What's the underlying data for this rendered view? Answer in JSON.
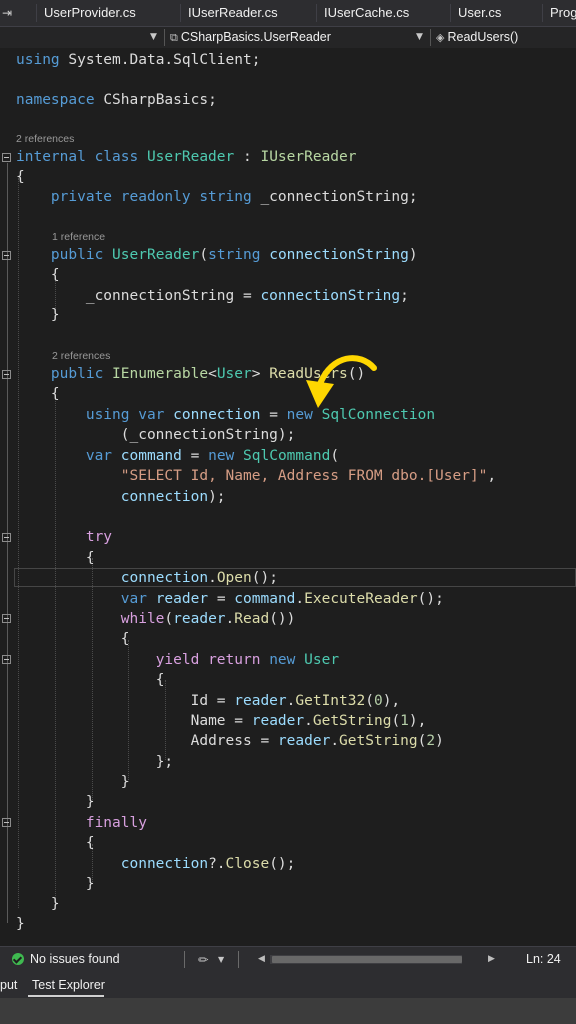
{
  "tabs": [
    {
      "label": "UserProvider.cs",
      "active": true
    },
    {
      "label": "IUserReader.cs"
    },
    {
      "label": "IUserCache.cs"
    },
    {
      "label": "User.cs"
    },
    {
      "label": "Prog"
    }
  ],
  "navigation": {
    "type_label": "CSharpBasics.UserReader",
    "member_label": "ReadUsers()"
  },
  "code_lens": {
    "class_refs": "2 references",
    "ctor_refs": "1 reference",
    "method_refs": "2 references"
  },
  "code": {
    "using_kw": "using",
    "using_ns": "System.Data.SqlClient;",
    "namespace_kw": "namespace",
    "namespace_name": "CSharpBasics;",
    "class_mods": "internal class",
    "class_name": "UserReader",
    "class_colon": ":",
    "interface_name": "IUserReader",
    "brace_open": "{",
    "brace_close": "}",
    "field_mods": "private readonly string",
    "field_name": "_connectionString;",
    "ctor_public": "public",
    "ctor_name": "UserReader",
    "ctor_paren": "(",
    "ctor_param_type": "string",
    "ctor_param_name": "connectionString",
    "ctor_paren_close": ")",
    "assign_lhs": "_connectionString =",
    "assign_rhs": "connectionString",
    "semicolon": ";",
    "method_public": "public",
    "method_return_type": "IEnumerable",
    "lt": "<",
    "generic_arg": "User",
    "gt": ">",
    "method_name": "ReadUsers",
    "method_parens": "()",
    "using_var": "using var",
    "conn_var": "connection",
    "eq": "=",
    "new_kw": "new",
    "sqlconn_type": "SqlConnection",
    "sqlconn_arg": "(_connectionString);",
    "var_kw": "var",
    "cmd_var": "command",
    "sqlcmd_type": "SqlCommand",
    "open_paren": "(",
    "sql_string": "\"SELECT Id, Name, Address FROM dbo.[User]\"",
    "comma": ",",
    "cmd_arg2": "connection",
    "close_paren_semi": ");",
    "try_kw": "try",
    "open_obj": "connection",
    "dot": ".",
    "open_method": "Open",
    "call_end": "();",
    "reader_var": "reader",
    "cmd_obj": "command",
    "exec_method": "ExecuteReader",
    "while_kw": "while",
    "read_method": "Read",
    "while_end": "())",
    "yield_kw": "yield return",
    "user_type": "User",
    "id_prop": "Id =",
    "getint_method": "GetInt32",
    "idx0": "0",
    "close_comma": "),",
    "name_prop": "Name =",
    "getstring_method": "GetString",
    "idx1": "1",
    "address_prop": "Address =",
    "idx2": "2",
    "close_only": ")",
    "end_obj": "};",
    "finally_kw": "finally",
    "null_cond": "?.",
    "close_method": "Close"
  },
  "status": {
    "issues": "No issues found",
    "line": "Ln: 24"
  },
  "bottom_tabs": [
    "put",
    "Test Explorer"
  ],
  "colors": {
    "keyword": "#569cd6",
    "control": "#d8a0df",
    "type": "#4ec9b0",
    "interface": "#b8d7a3",
    "method": "#dcdcaa",
    "variable": "#9cdcfe",
    "string": "#d69d85",
    "number": "#b5cea8",
    "arrow": "#ffd700",
    "ok": "#3fb950"
  }
}
